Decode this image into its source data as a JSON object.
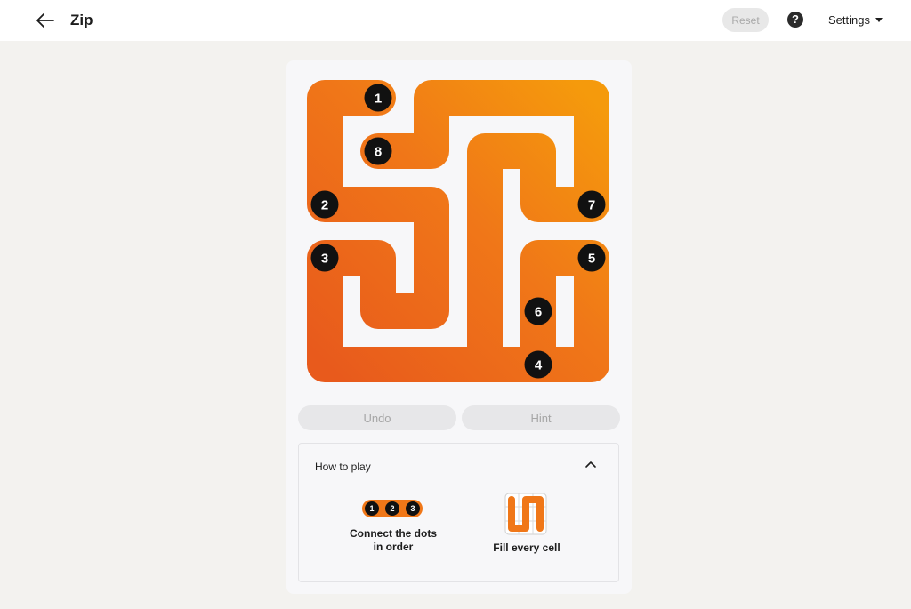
{
  "header": {
    "title": "Zip",
    "reset_label": "Reset",
    "help_glyph": "?",
    "settings_label": "Settings"
  },
  "board": {
    "grid_size": 6,
    "path_cells": [
      [
        1,
        0
      ],
      [
        0,
        0
      ],
      [
        0,
        1
      ],
      [
        0,
        2
      ],
      [
        1,
        2
      ],
      [
        2,
        2
      ],
      [
        2,
        3
      ],
      [
        2,
        4
      ],
      [
        1,
        4
      ],
      [
        1,
        3
      ],
      [
        0,
        3
      ],
      [
        0,
        4
      ],
      [
        0,
        5
      ],
      [
        1,
        5
      ],
      [
        2,
        5
      ],
      [
        3,
        5
      ],
      [
        4,
        5
      ],
      [
        5,
        5
      ],
      [
        5,
        4
      ],
      [
        5,
        3
      ],
      [
        4,
        3
      ],
      [
        4,
        4
      ],
      [
        4,
        5
      ],
      [
        3,
        5
      ],
      [
        3,
        4
      ],
      [
        3,
        3
      ],
      [
        3,
        2
      ],
      [
        3,
        1
      ],
      [
        4,
        1
      ],
      [
        4,
        2
      ],
      [
        5,
        2
      ],
      [
        5,
        1
      ],
      [
        5,
        0
      ],
      [
        4,
        0
      ],
      [
        3,
        0
      ],
      [
        2,
        0
      ],
      [
        2,
        1
      ],
      [
        1,
        1
      ]
    ],
    "checkpoints": [
      {
        "label": "1",
        "col": 1,
        "row": 0
      },
      {
        "label": "2",
        "col": 0,
        "row": 2
      },
      {
        "label": "3",
        "col": 0,
        "row": 3
      },
      {
        "label": "4",
        "col": 4,
        "row": 5
      },
      {
        "label": "5",
        "col": 5,
        "row": 3
      },
      {
        "label": "6",
        "col": 4,
        "row": 4
      },
      {
        "label": "7",
        "col": 5,
        "row": 2
      },
      {
        "label": "8",
        "col": 1,
        "row": 1
      }
    ],
    "colors": {
      "start": "#e85a1c",
      "mid": "#f07718",
      "end": "#f59a0c",
      "dot": "#111111",
      "dot_text": "#ffffff"
    }
  },
  "controls": {
    "undo_label": "Undo",
    "hint_label": "Hint"
  },
  "how_to_play": {
    "title": "How to play",
    "toggle_icon": "chevron-up-icon",
    "example_dots": [
      "1",
      "2",
      "3"
    ],
    "tip1": "Connect the dots in order",
    "tip2": "Fill every cell"
  }
}
